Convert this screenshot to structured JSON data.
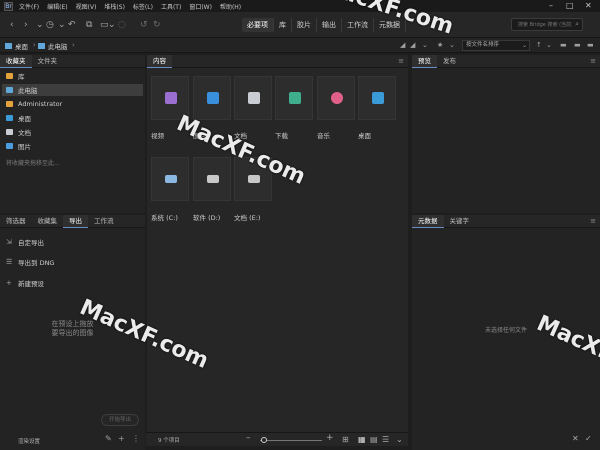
{
  "menubar": {
    "items": [
      "文件(F)",
      "编辑(E)",
      "视图(V)",
      "堆栈(S)",
      "标签(L)",
      "工具(T)",
      "窗口(W)",
      "帮助(H)"
    ]
  },
  "toolbar": {
    "workspaces": [
      "必要项",
      "库",
      "胶片",
      "输出",
      "工作流",
      "元数据"
    ],
    "search_placeholder": "搜索 Bridge 搜索 (当前)"
  },
  "pathbar": {
    "crumbs": [
      "桌面",
      "此电脑"
    ],
    "sort_label": "按文件名排序"
  },
  "left_top": {
    "tabs": [
      "收藏夹",
      "文件夹"
    ],
    "items": [
      {
        "label": "库",
        "color": "#e3a23b"
      },
      {
        "label": "此电脑",
        "color": "#5fa8d9"
      },
      {
        "label": "Administrator",
        "color": "#e3a23b"
      },
      {
        "label": "桌面",
        "color": "#3a9bd8"
      },
      {
        "label": "文档",
        "color": "#c9ccd3"
      },
      {
        "label": "图片",
        "color": "#4c9de0"
      }
    ],
    "hint": "将收藏夹拖移至此..."
  },
  "left_bottom": {
    "tabs": [
      "筛选器",
      "收藏集",
      "导出",
      "工作流"
    ],
    "items": [
      "自定导出",
      "导出到 DNG",
      "新建预设"
    ],
    "hint": "在预设上拖放要导出的图像",
    "button": "开始导出",
    "footer": "渲染设置"
  },
  "content": {
    "tab": "内容",
    "tiles": [
      {
        "label": "视频",
        "color": "#9b6fd1"
      },
      {
        "label": "图片",
        "color": "#3a8fdc"
      },
      {
        "label": "文档",
        "color": "#c9ccd3"
      },
      {
        "label": "下载",
        "color": "#3fae8c"
      },
      {
        "label": "音乐",
        "color": "#e0608a"
      },
      {
        "label": "桌面",
        "color": "#3a9bd8"
      },
      {
        "label": "系统 (C:)",
        "color": "#8bb8e0"
      },
      {
        "label": "软件 (D:)",
        "color": "#c8c8c8"
      },
      {
        "label": "文档 (E:)",
        "color": "#c8c8c8"
      }
    ],
    "status": "9 个项目"
  },
  "right_top": {
    "tabs": [
      "预览",
      "发布"
    ]
  },
  "right_bottom": {
    "tabs": [
      "元数据",
      "关键字"
    ],
    "hint": "未选择任何文件"
  },
  "watermarks": [
    "MacXF.com",
    "MacXF.com",
    "MacXF.com",
    "MacXF.com",
    "MacXF.com"
  ]
}
